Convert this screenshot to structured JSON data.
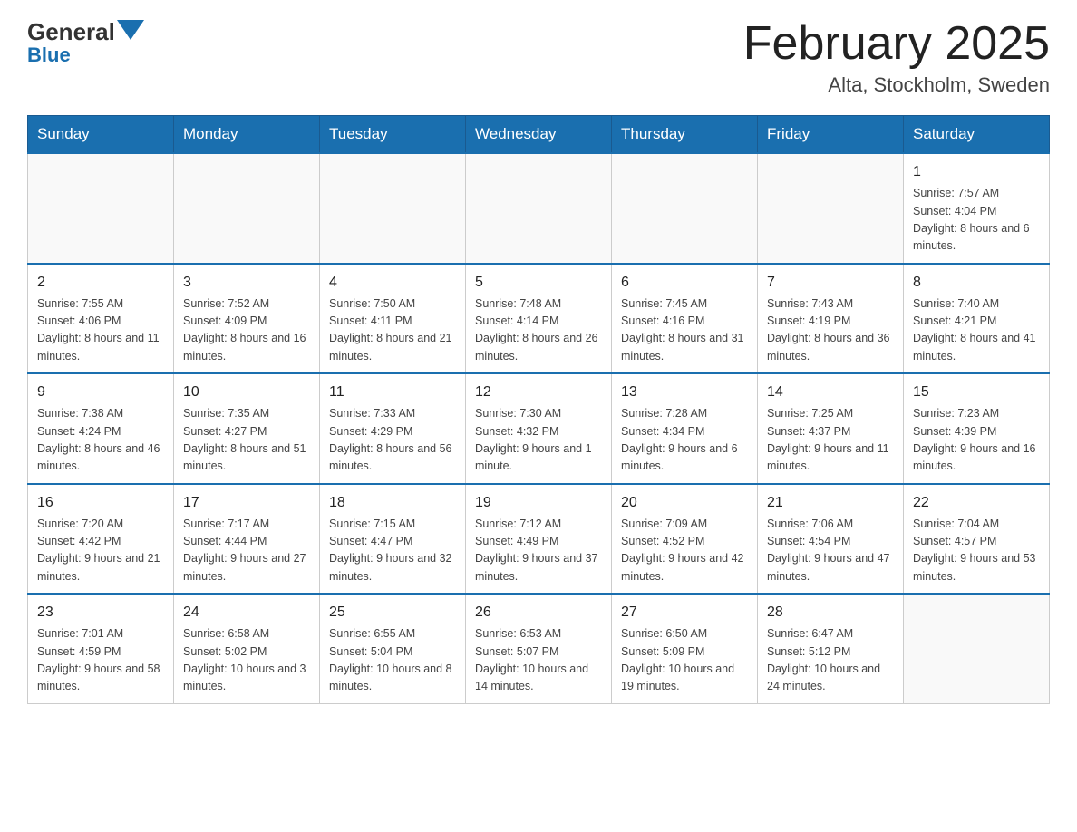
{
  "header": {
    "logo": {
      "general": "General",
      "blue": "Blue"
    },
    "title": "February 2025",
    "location": "Alta, Stockholm, Sweden"
  },
  "days_of_week": [
    "Sunday",
    "Monday",
    "Tuesday",
    "Wednesday",
    "Thursday",
    "Friday",
    "Saturday"
  ],
  "weeks": [
    [
      {
        "day": "",
        "info": ""
      },
      {
        "day": "",
        "info": ""
      },
      {
        "day": "",
        "info": ""
      },
      {
        "day": "",
        "info": ""
      },
      {
        "day": "",
        "info": ""
      },
      {
        "day": "",
        "info": ""
      },
      {
        "day": "1",
        "info": "Sunrise: 7:57 AM\nSunset: 4:04 PM\nDaylight: 8 hours and 6 minutes."
      }
    ],
    [
      {
        "day": "2",
        "info": "Sunrise: 7:55 AM\nSunset: 4:06 PM\nDaylight: 8 hours and 11 minutes."
      },
      {
        "day": "3",
        "info": "Sunrise: 7:52 AM\nSunset: 4:09 PM\nDaylight: 8 hours and 16 minutes."
      },
      {
        "day": "4",
        "info": "Sunrise: 7:50 AM\nSunset: 4:11 PM\nDaylight: 8 hours and 21 minutes."
      },
      {
        "day": "5",
        "info": "Sunrise: 7:48 AM\nSunset: 4:14 PM\nDaylight: 8 hours and 26 minutes."
      },
      {
        "day": "6",
        "info": "Sunrise: 7:45 AM\nSunset: 4:16 PM\nDaylight: 8 hours and 31 minutes."
      },
      {
        "day": "7",
        "info": "Sunrise: 7:43 AM\nSunset: 4:19 PM\nDaylight: 8 hours and 36 minutes."
      },
      {
        "day": "8",
        "info": "Sunrise: 7:40 AM\nSunset: 4:21 PM\nDaylight: 8 hours and 41 minutes."
      }
    ],
    [
      {
        "day": "9",
        "info": "Sunrise: 7:38 AM\nSunset: 4:24 PM\nDaylight: 8 hours and 46 minutes."
      },
      {
        "day": "10",
        "info": "Sunrise: 7:35 AM\nSunset: 4:27 PM\nDaylight: 8 hours and 51 minutes."
      },
      {
        "day": "11",
        "info": "Sunrise: 7:33 AM\nSunset: 4:29 PM\nDaylight: 8 hours and 56 minutes."
      },
      {
        "day": "12",
        "info": "Sunrise: 7:30 AM\nSunset: 4:32 PM\nDaylight: 9 hours and 1 minute."
      },
      {
        "day": "13",
        "info": "Sunrise: 7:28 AM\nSunset: 4:34 PM\nDaylight: 9 hours and 6 minutes."
      },
      {
        "day": "14",
        "info": "Sunrise: 7:25 AM\nSunset: 4:37 PM\nDaylight: 9 hours and 11 minutes."
      },
      {
        "day": "15",
        "info": "Sunrise: 7:23 AM\nSunset: 4:39 PM\nDaylight: 9 hours and 16 minutes."
      }
    ],
    [
      {
        "day": "16",
        "info": "Sunrise: 7:20 AM\nSunset: 4:42 PM\nDaylight: 9 hours and 21 minutes."
      },
      {
        "day": "17",
        "info": "Sunrise: 7:17 AM\nSunset: 4:44 PM\nDaylight: 9 hours and 27 minutes."
      },
      {
        "day": "18",
        "info": "Sunrise: 7:15 AM\nSunset: 4:47 PM\nDaylight: 9 hours and 32 minutes."
      },
      {
        "day": "19",
        "info": "Sunrise: 7:12 AM\nSunset: 4:49 PM\nDaylight: 9 hours and 37 minutes."
      },
      {
        "day": "20",
        "info": "Sunrise: 7:09 AM\nSunset: 4:52 PM\nDaylight: 9 hours and 42 minutes."
      },
      {
        "day": "21",
        "info": "Sunrise: 7:06 AM\nSunset: 4:54 PM\nDaylight: 9 hours and 47 minutes."
      },
      {
        "day": "22",
        "info": "Sunrise: 7:04 AM\nSunset: 4:57 PM\nDaylight: 9 hours and 53 minutes."
      }
    ],
    [
      {
        "day": "23",
        "info": "Sunrise: 7:01 AM\nSunset: 4:59 PM\nDaylight: 9 hours and 58 minutes."
      },
      {
        "day": "24",
        "info": "Sunrise: 6:58 AM\nSunset: 5:02 PM\nDaylight: 10 hours and 3 minutes."
      },
      {
        "day": "25",
        "info": "Sunrise: 6:55 AM\nSunset: 5:04 PM\nDaylight: 10 hours and 8 minutes."
      },
      {
        "day": "26",
        "info": "Sunrise: 6:53 AM\nSunset: 5:07 PM\nDaylight: 10 hours and 14 minutes."
      },
      {
        "day": "27",
        "info": "Sunrise: 6:50 AM\nSunset: 5:09 PM\nDaylight: 10 hours and 19 minutes."
      },
      {
        "day": "28",
        "info": "Sunrise: 6:47 AM\nSunset: 5:12 PM\nDaylight: 10 hours and 24 minutes."
      },
      {
        "day": "",
        "info": ""
      }
    ]
  ]
}
